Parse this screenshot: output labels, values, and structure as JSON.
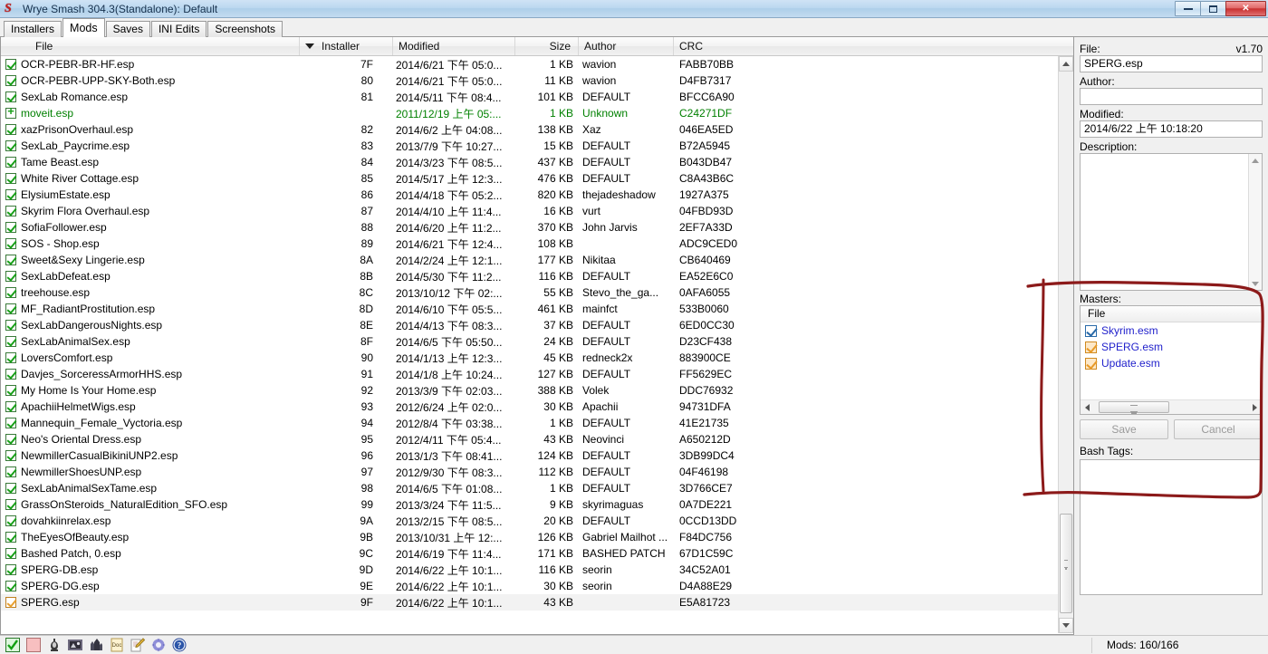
{
  "window": {
    "title": "Wrye Smash 304.3(Standalone): Default",
    "icon": "wrye-smash-logo",
    "minimize_label": "–",
    "maximize_label": "❐",
    "close_label": "✕"
  },
  "tabs": [
    {
      "label": "Installers",
      "active": false
    },
    {
      "label": "Mods",
      "active": true
    },
    {
      "label": "Saves",
      "active": false
    },
    {
      "label": "INI Edits",
      "active": false
    },
    {
      "label": "Screenshots",
      "active": false
    }
  ],
  "table": {
    "columns": [
      "File",
      "Installer",
      "Modified",
      "Size",
      "Author",
      "CRC"
    ],
    "sorted_column": "Installer",
    "sort_direction": "descending",
    "rows": [
      {
        "file": "OCR-PEBR-BR-HF.esp",
        "state": "checked",
        "installer": "7F",
        "modified": "2014/6/21 下午 05:0...",
        "size": "1 KB",
        "author": "wavion",
        "crc": "FABB70BB",
        "selected": false
      },
      {
        "file": "OCR-PEBR-UPP-SKY-Both.esp",
        "state": "checked",
        "installer": "80",
        "modified": "2014/6/21 下午 05:0...",
        "size": "11 KB",
        "author": "wavion",
        "crc": "D4FB7317",
        "selected": false
      },
      {
        "file": "SexLab Romance.esp",
        "state": "checked",
        "installer": "81",
        "modified": "2014/5/11 下午 08:4...",
        "size": "101 KB",
        "author": "DEFAULT",
        "crc": "BFCC6A90",
        "selected": false
      },
      {
        "file": "moveit.esp",
        "state": "plus",
        "installer": "",
        "modified": "2011/12/19 上午 05:...",
        "size": "1 KB",
        "author": "Unknown",
        "crc": "C24271DF",
        "selected": false,
        "green": true
      },
      {
        "file": "xazPrisonOverhaul.esp",
        "state": "checked",
        "installer": "82",
        "modified": "2014/6/2 上午 04:08...",
        "size": "138 KB",
        "author": "Xaz",
        "crc": "046EA5ED",
        "selected": false
      },
      {
        "file": "SexLab_Paycrime.esp",
        "state": "checked",
        "installer": "83",
        "modified": "2013/7/9 下午 10:27...",
        "size": "15 KB",
        "author": "DEFAULT",
        "crc": "B72A5945",
        "selected": false
      },
      {
        "file": "Tame Beast.esp",
        "state": "checked",
        "installer": "84",
        "modified": "2014/3/23 下午 08:5...",
        "size": "437 KB",
        "author": "DEFAULT",
        "crc": "B043DB47",
        "selected": false
      },
      {
        "file": "White River Cottage.esp",
        "state": "checked",
        "installer": "85",
        "modified": "2014/5/17 上午 12:3...",
        "size": "476 KB",
        "author": "DEFAULT",
        "crc": "C8A43B6C",
        "selected": false
      },
      {
        "file": "ElysiumEstate.esp",
        "state": "checked",
        "installer": "86",
        "modified": "2014/4/18 下午 05:2...",
        "size": "820 KB",
        "author": "thejadeshadow",
        "crc": "1927A375",
        "selected": false
      },
      {
        "file": "Skyrim Flora Overhaul.esp",
        "state": "checked",
        "installer": "87",
        "modified": "2014/4/10 上午 11:4...",
        "size": "16 KB",
        "author": "vurt",
        "crc": "04FBD93D",
        "selected": false
      },
      {
        "file": "SofiaFollower.esp",
        "state": "checked",
        "installer": "88",
        "modified": "2014/6/20 上午 11:2...",
        "size": "370 KB",
        "author": "John Jarvis",
        "crc": "2EF7A33D",
        "selected": false
      },
      {
        "file": "SOS - Shop.esp",
        "state": "checked",
        "installer": "89",
        "modified": "2014/6/21 下午 12:4...",
        "size": "108 KB",
        "author": "",
        "crc": "ADC9CED0",
        "selected": false
      },
      {
        "file": "Sweet&Sexy Lingerie.esp",
        "state": "checked",
        "installer": "8A",
        "modified": "2014/2/24 上午 12:1...",
        "size": "177 KB",
        "author": "Nikitaa",
        "crc": "CB640469",
        "selected": false
      },
      {
        "file": "SexLabDefeat.esp",
        "state": "checked",
        "installer": "8B",
        "modified": "2014/5/30 下午 11:2...",
        "size": "116 KB",
        "author": "DEFAULT",
        "crc": "EA52E6C0",
        "selected": false
      },
      {
        "file": "treehouse.esp",
        "state": "checked",
        "installer": "8C",
        "modified": "2013/10/12 下午 02:...",
        "size": "55 KB",
        "author": "Stevo_the_ga...",
        "crc": "0AFA6055",
        "selected": false
      },
      {
        "file": "MF_RadiantProstitution.esp",
        "state": "checked",
        "installer": "8D",
        "modified": "2014/6/10 下午 05:5...",
        "size": "461 KB",
        "author": "mainfct",
        "crc": "533B0060",
        "selected": false
      },
      {
        "file": "SexLabDangerousNights.esp",
        "state": "checked",
        "installer": "8E",
        "modified": "2014/4/13 下午 08:3...",
        "size": "37 KB",
        "author": "DEFAULT",
        "crc": "6ED0CC30",
        "selected": false
      },
      {
        "file": "SexLabAnimalSex.esp",
        "state": "checked",
        "installer": "8F",
        "modified": "2014/6/5 下午 05:50...",
        "size": "24 KB",
        "author": "DEFAULT",
        "crc": "D23CF438",
        "selected": false
      },
      {
        "file": "LoversComfort.esp",
        "state": "checked",
        "installer": "90",
        "modified": "2014/1/13 上午 12:3...",
        "size": "45 KB",
        "author": "redneck2x",
        "crc": "883900CE",
        "selected": false
      },
      {
        "file": "Davjes_SorceressArmorHHS.esp",
        "state": "checked",
        "installer": "91",
        "modified": "2014/1/8 上午 10:24...",
        "size": "127 KB",
        "author": "DEFAULT",
        "crc": "FF5629EC",
        "selected": false
      },
      {
        "file": "My Home Is Your Home.esp",
        "state": "checked",
        "installer": "92",
        "modified": "2013/3/9 下午 02:03...",
        "size": "388 KB",
        "author": "Volek",
        "crc": "DDC76932",
        "selected": false
      },
      {
        "file": "ApachiiHelmetWigs.esp",
        "state": "checked",
        "installer": "93",
        "modified": "2012/6/24 上午 02:0...",
        "size": "30 KB",
        "author": "Apachii",
        "crc": "94731DFA",
        "selected": false
      },
      {
        "file": "Mannequin_Female_Vyctoria.esp",
        "state": "checked",
        "installer": "94",
        "modified": "2012/8/4 下午 03:38...",
        "size": "1 KB",
        "author": "DEFAULT",
        "crc": "41E21735",
        "selected": false
      },
      {
        "file": "Neo's Oriental Dress.esp",
        "state": "checked",
        "installer": "95",
        "modified": "2012/4/11 下午 05:4...",
        "size": "43 KB",
        "author": "Neovinci",
        "crc": "A650212D",
        "selected": false
      },
      {
        "file": "NewmillerCasualBikiniUNP2.esp",
        "state": "checked",
        "installer": "96",
        "modified": "2013/1/3 下午 08:41...",
        "size": "124 KB",
        "author": "DEFAULT",
        "crc": "3DB99DC4",
        "selected": false
      },
      {
        "file": "NewmillerShoesUNP.esp",
        "state": "checked",
        "installer": "97",
        "modified": "2012/9/30 下午 08:3...",
        "size": "112 KB",
        "author": "DEFAULT",
        "crc": "04F46198",
        "selected": false
      },
      {
        "file": "SexLabAnimalSexTame.esp",
        "state": "checked",
        "installer": "98",
        "modified": "2014/6/5 下午 01:08...",
        "size": "1 KB",
        "author": "DEFAULT",
        "crc": "3D766CE7",
        "selected": false
      },
      {
        "file": "GrassOnSteroids_NaturalEdition_SFO.esp",
        "state": "checked",
        "installer": "99",
        "modified": "2013/3/24 下午 11:5...",
        "size": "9 KB",
        "author": "skyrimaguas",
        "crc": "0A7DE221",
        "selected": false
      },
      {
        "file": "dovahkiinrelax.esp",
        "state": "checked",
        "installer": "9A",
        "modified": "2013/2/15 下午 08:5...",
        "size": "20 KB",
        "author": "DEFAULT",
        "crc": "0CCD13DD",
        "selected": false
      },
      {
        "file": "TheEyesOfBeauty.esp",
        "state": "checked",
        "installer": "9B",
        "modified": "2013/10/31 上午 12:...",
        "size": "126 KB",
        "author": "Gabriel Mailhot ...",
        "crc": "F84DC756",
        "selected": false
      },
      {
        "file": "Bashed Patch, 0.esp",
        "state": "checked",
        "installer": "9C",
        "modified": "2014/6/19 下午 11:4...",
        "size": "171 KB",
        "author": "BASHED PATCH",
        "crc": "67D1C59C",
        "selected": false
      },
      {
        "file": "SPERG-DB.esp",
        "state": "checked",
        "installer": "9D",
        "modified": "2014/6/22 上午 10:1...",
        "size": "116 KB",
        "author": "seorin",
        "crc": "34C52A01",
        "selected": false
      },
      {
        "file": "SPERG-DG.esp",
        "state": "checked",
        "installer": "9E",
        "modified": "2014/6/22 上午 10:1...",
        "size": "30 KB",
        "author": "seorin",
        "crc": "D4A88E29",
        "selected": false
      },
      {
        "file": "SPERG.esp",
        "state": "orange",
        "installer": "9F",
        "modified": "2014/6/22 上午 10:1...",
        "size": "43 KB",
        "author": "",
        "crc": "E5A81723",
        "selected": true
      }
    ]
  },
  "details": {
    "file_label": "File:",
    "version": "v1.70",
    "file_value": "SPERG.esp",
    "author_label": "Author:",
    "author_value": "",
    "modified_label": "Modified:",
    "modified_value": "2014/6/22 上午 10:18:20",
    "description_label": "Description:",
    "description_value": "",
    "masters_label": "Masters:",
    "masters_column": "File",
    "masters": [
      {
        "name": "Skyrim.esm",
        "check": "blue"
      },
      {
        "name": "SPERG.esm",
        "check": "orange"
      },
      {
        "name": "Update.esm",
        "check": "orange"
      }
    ],
    "save_label": "Save",
    "cancel_label": "Cancel",
    "bash_tags_label": "Bash Tags:",
    "bash_tags_value": ""
  },
  "statusbar": {
    "icons": [
      "green-check-icon",
      "pink-square-icon",
      "oblivion-lamp-icon",
      "skyrim-tes-icon",
      "city-icon",
      "doc-icon",
      "notepad-pencil-icon",
      "settings-gear-icon",
      "help-question-icon"
    ],
    "mods_count": "Mods: 160/166"
  },
  "annotation": {
    "type": "hand-drawn-red-rectangle",
    "color": "#8c1a1a",
    "target": "masters-panel"
  }
}
